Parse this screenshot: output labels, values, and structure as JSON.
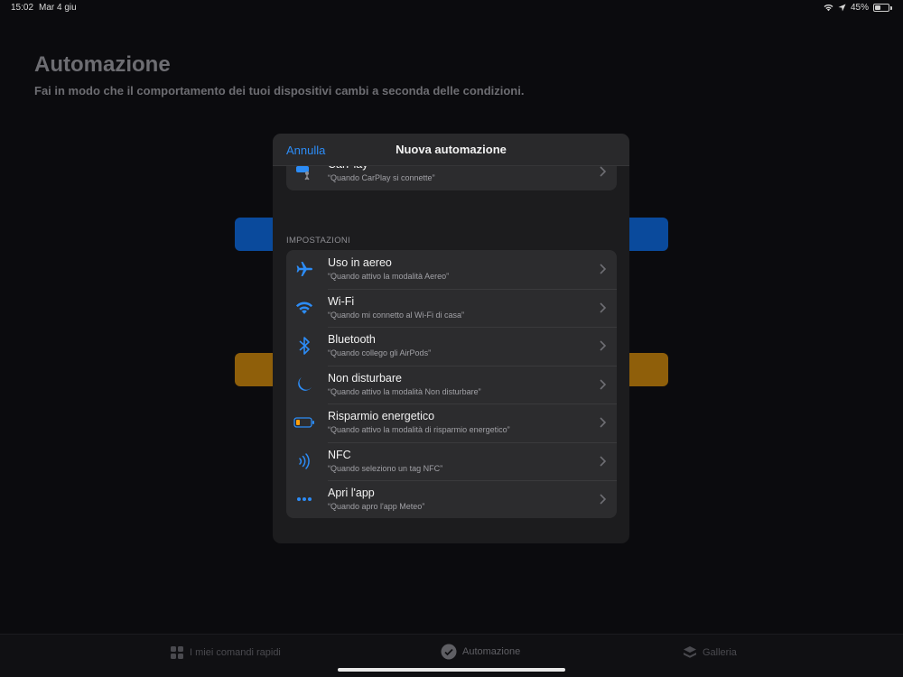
{
  "status_bar": {
    "time": "15:02",
    "date": "Mar 4 giu",
    "battery": "45%",
    "battery_level": 0.45
  },
  "page": {
    "title": "Automazione",
    "subtitle": "Fai in modo che il comportamento dei tuoi dispositivi cambi a seconda delle condizioni."
  },
  "modal": {
    "cancel_label": "Annulla",
    "title": "Nuova automazione",
    "partial_row": {
      "title": "CarPlay",
      "subtitle": "“Quando CarPlay si connette”",
      "icon": "car-icon"
    },
    "section_label": "IMPOSTAZIONI",
    "items": [
      {
        "title": "Uso in aereo",
        "subtitle": "“Quando attivo la modalità Aereo”",
        "icon": "airplane-icon"
      },
      {
        "title": "Wi-Fi",
        "subtitle": "“Quando mi connetto al Wi-Fi di casa”",
        "icon": "wifi-icon"
      },
      {
        "title": "Bluetooth",
        "subtitle": "“Quando collego gli AirPods”",
        "icon": "bluetooth-icon"
      },
      {
        "title": "Non disturbare",
        "subtitle": "“Quando attivo la modalità Non disturbare”",
        "icon": "moon-icon"
      },
      {
        "title": "Risparmio energetico",
        "subtitle": "“Quando attivo la modalità di risparmio energetico”",
        "icon": "battery-low-icon"
      },
      {
        "title": "NFC",
        "subtitle": "“Quando seleziono un tag NFC”",
        "icon": "nfc-icon"
      },
      {
        "title": "Apri l'app",
        "subtitle": "“Quando apro l'app Meteo”",
        "icon": "more-icon"
      }
    ]
  },
  "tab_bar": {
    "tabs": [
      {
        "label": "I miei comandi rapidi",
        "icon": "grid-icon"
      },
      {
        "label": "Automazione",
        "icon": "automation-icon"
      },
      {
        "label": "Galleria",
        "icon": "layers-icon"
      }
    ]
  },
  "colors": {
    "accent": "#2c8cf6",
    "sheet_bg": "#1c1c1e",
    "cell_bg": "#2c2c2e",
    "bg_button_blue": "#0a4a9c",
    "bg_button_orange": "#8f5f0a"
  }
}
